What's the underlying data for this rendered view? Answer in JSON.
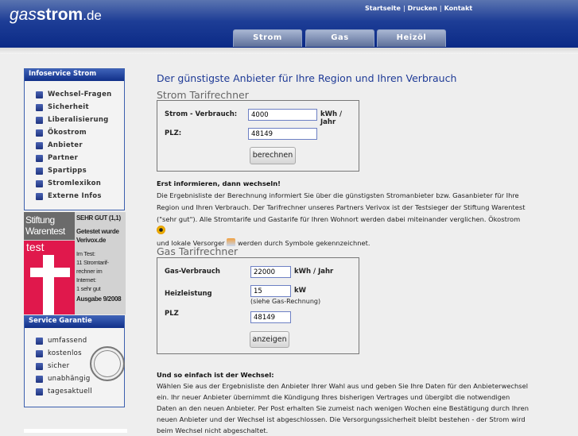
{
  "header": {
    "logo_prefix": "gas",
    "logo_main": "strom",
    "logo_tld": ".de",
    "links": [
      "Startseite",
      "Drucken",
      "Kontakt"
    ],
    "tabs": [
      "Strom",
      "Gas",
      "Heizöl"
    ]
  },
  "sidebar": {
    "infoservice": {
      "title": "Infoservice Strom",
      "items": [
        "Wechsel-Fragen",
        "Sicherheit",
        "Liberalisierung",
        "Ökostrom",
        "Anbieter",
        "Partner",
        "Spartipps",
        "Stromlexikon",
        "Externe Infos"
      ]
    },
    "warentest": {
      "brand1": "Stiftung",
      "brand2": "Warentest",
      "test": "test",
      "rating": "SEHR GUT (1,1)",
      "tested": "Getestet wurde Verivox.de",
      "detail": [
        "Im Test:",
        "11 Stromtarif-",
        "rechner im",
        "Internet:",
        "1 sehr gut"
      ],
      "issue": "Ausgabe 9/2008"
    },
    "garantie": {
      "title": "Service Garantie",
      "items": [
        "umfassend",
        "kostenlos",
        "sicher",
        "unabhängig",
        "tagesaktuell"
      ],
      "stamp_text": "GARANTIE WARRANTY"
    }
  },
  "main": {
    "title": "Der günstigste Anbieter für Ihre Region und Ihren Verbrauch",
    "strom": {
      "heading": "Strom Tarifrechner",
      "verbrauch_label": "Strom - Verbrauch:",
      "verbrauch_value": "4000",
      "verbrauch_unit": "kWh / Jahr",
      "plz_label": "PLZ:",
      "plz_value": "48149",
      "button": "berechnen"
    },
    "info": {
      "heading": "Erst informieren, dann wechseln!",
      "text1": "Die Ergebnisliste der Berechnung informiert Sie über die günstigsten Stromanbieter bzw. Gasanbieter für Ihre Region und Ihren Verbrauch. Der Tarifrechner unseres Partners Verivox ist der Testsieger der Stiftung Warentest (\"sehr gut\"). Alle Stromtarife und Gastarife für Ihren Wohnort werden dabei miteinander verglichen. Ökostrom",
      "text2": "und lokale Versorger",
      "text3": "werden durch Symbole gekennzeichnet."
    },
    "gas": {
      "heading": "Gas Tarifrechner",
      "verbrauch_label": "Gas-Verbrauch",
      "verbrauch_value": "22000",
      "verbrauch_unit": "kWh / Jahr",
      "heiz_label": "Heizleistung",
      "heiz_value": "15",
      "heiz_unit": "kW",
      "heiz_hint": "(siehe Gas-Rechnung)",
      "plz_label": "PLZ",
      "plz_value": "48149",
      "button": "anzeigen"
    },
    "wechsel": {
      "heading": "Und so einfach ist der Wechsel:",
      "text": "Wählen Sie aus der Ergebnisliste den Anbieter Ihrer Wahl aus und geben Sie Ihre Daten für den Anbieterwechsel ein. Ihr neuer Anbieter übernimmt die Kündigung Ihres bisherigen Vertrages und übergibt die notwendigen Daten an den neuen Anbieter. Per Post erhalten Sie zumeist nach wenigen Wochen eine Bestätigung durch Ihren neuen Anbieter und der Wechsel ist abgeschlossen. Die Versorgungssicherheit bleibt bestehen - der Strom wird beim Wechsel nicht abgeschaltet."
    }
  }
}
